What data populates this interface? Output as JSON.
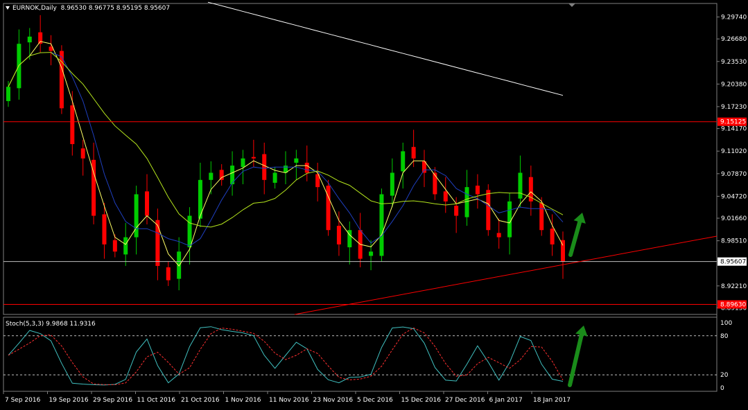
{
  "header": {
    "symbol": "EURNOK,Daily",
    "ohlc": "8.96530 8.96775 8.95195 8.95607"
  },
  "subwindow": {
    "label": "Stoch(5,3,3) 9.9868 11.9316",
    "levels": [
      "100",
      "80",
      "20",
      "0"
    ]
  },
  "price_axis": {
    "labels": [
      "9.29740",
      "9.26680",
      "9.23530",
      "9.20380",
      "9.17230",
      "9.14170",
      "9.11020",
      "9.07870",
      "9.04720",
      "9.01660",
      "8.98510",
      "8.92210",
      "8.89150"
    ],
    "highlight_red_upper": "9.15125",
    "highlight_red_lower": "8.89630",
    "current_price": "8.95607"
  },
  "time_axis": {
    "labels": [
      "7 Sep 2016",
      "19 Sep 2016",
      "29 Sep 2016",
      "11 Oct 2016",
      "21 Oct 2016",
      "1 Nov 2016",
      "11 Nov 2016",
      "23 Nov 2016",
      "5 Dec 2016",
      "15 Dec 2016",
      "27 Dec 2016",
      "6 Jan 2017",
      "18 Jan 2017"
    ]
  },
  "colors": {
    "background": "#000000",
    "bull": "#00cc00",
    "bear": "#ff0000",
    "ma_fast": "#ffff66",
    "ma_mid": "#1f3fbf",
    "ma_slow": "#b5e61d",
    "ma_long": "#ffffff",
    "stoch_main": "#40c0c0",
    "stoch_signal": "#ff3030",
    "arrow": "#1a8c1a"
  },
  "chart_data": {
    "type": "candlestick",
    "title": "EURNOK,Daily",
    "ylim": [
      8.88,
      9.315
    ],
    "x_dates": [
      "7 Sep 2016",
      "19 Sep 2016",
      "29 Sep 2016",
      "11 Oct 2016",
      "21 Oct 2016",
      "1 Nov 2016",
      "11 Nov 2016",
      "23 Nov 2016",
      "5 Dec 2016",
      "15 Dec 2016",
      "27 Dec 2016",
      "6 Jan 2017",
      "18 Jan 2017"
    ],
    "close_series_approx": [
      9.2,
      9.26,
      9.27,
      9.26,
      9.25,
      9.17,
      9.12,
      9.1,
      9.02,
      8.98,
      8.97,
      8.99,
      9.05,
      9.02,
      8.95,
      8.93,
      8.97,
      9.02,
      9.07,
      9.08,
      9.07,
      9.09,
      9.1,
      9.1,
      9.07,
      9.08,
      9.09,
      9.1,
      9.08,
      9.06,
      9.0,
      8.98,
      9.0,
      8.96,
      8.97,
      9.05,
      9.08,
      9.11,
      9.1,
      9.08,
      9.05,
      9.04,
      9.02,
      9.06,
      9.05,
      9.0,
      8.99,
      9.04,
      9.08,
      9.04,
      9.0,
      8.98,
      8.956
    ],
    "horizontal_lines": [
      9.15125,
      8.8963,
      8.95607
    ],
    "stochastic": {
      "name": "Stoch(5,3,3)",
      "main": 9.9868,
      "signal": 11.9316,
      "levels": [
        80,
        20
      ],
      "ylim": [
        0,
        100
      ]
    }
  }
}
